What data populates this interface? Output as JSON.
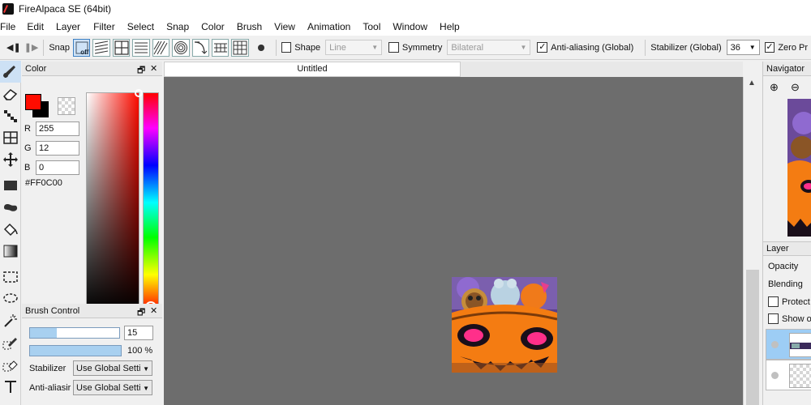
{
  "window": {
    "title": "FireAlpaca SE (64bit)"
  },
  "menu": [
    "File",
    "Edit",
    "Layer",
    "Filter",
    "Select",
    "Snap",
    "Color",
    "Brush",
    "View",
    "Animation",
    "Tool",
    "Window",
    "Help"
  ],
  "toolbar": {
    "snap_label": "Snap",
    "snap_off_label": "off",
    "shape_label": "Shape",
    "shape_value": "Line",
    "symmetry_label": "Symmetry",
    "symmetry_value": "Bilateral",
    "antialias_label": "Anti-aliasing (Global)",
    "stabilizer_label": "Stabilizer (Global)",
    "stabilizer_value": "36",
    "zero_label": "Zero Pr"
  },
  "color_panel": {
    "title": "Color",
    "r_label": "R",
    "r_value": "255",
    "g_label": "G",
    "g_value": "12",
    "b_label": "B",
    "b_value": "0",
    "hex": "#FF0C00",
    "foreground": "#ff0c00",
    "background": "#000000"
  },
  "brush_panel": {
    "title": "Brush Control",
    "size_value": "15",
    "opacity_text": "100 %",
    "size_fraction": 0.3,
    "opacity_fraction": 1.0,
    "stabilizer_label": "Stabilizer",
    "stabilizer_value": "Use Global Setti",
    "antialias_label": "Anti-aliasir",
    "antialias_value": "Use Global Setti"
  },
  "canvas": {
    "tab_title": "Untitled",
    "background": "#6d6d6d"
  },
  "navigator": {
    "title": "Navigator"
  },
  "layer_panel": {
    "title": "Layer",
    "opacity_label": "Opacity",
    "blending_label": "Blending",
    "protect_label": "Protect",
    "show_label": "Show o"
  }
}
